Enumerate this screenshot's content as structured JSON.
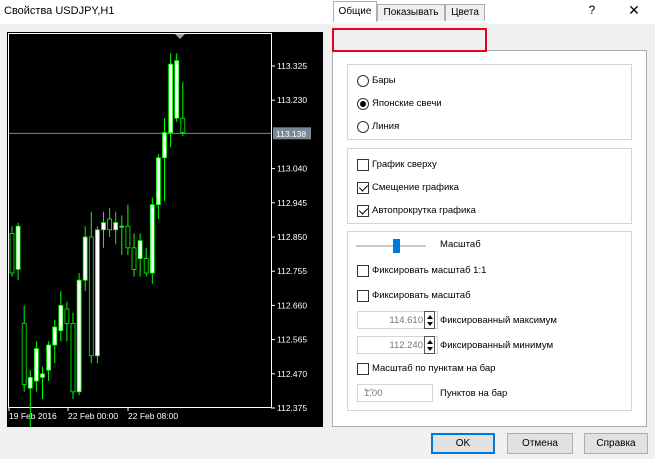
{
  "window": {
    "title": "Свойства USDJPY,H1",
    "help_label": "?",
    "close_label": "✕"
  },
  "chart": {
    "background_color": "#000000",
    "bull_color": "#ffffff",
    "bear_color": "#000000",
    "outline_color": "#00ff00",
    "price_line_color": "#778899",
    "current_price": "113.138",
    "price_ticks": [
      "113.325",
      "113.230",
      "113.040",
      "112.945",
      "112.850",
      "112.755",
      "112.660",
      "112.565",
      "112.470",
      "112.375"
    ],
    "time_ticks": [
      "19 Feb 2016",
      "22 Feb 00:00",
      "22 Feb 08:00"
    ],
    "candles": [
      {
        "o": 112.86,
        "h": 112.88,
        "l": 112.74,
        "c": 112.75
      },
      {
        "o": 112.76,
        "h": 112.89,
        "l": 112.73,
        "c": 112.88
      },
      {
        "o": 112.61,
        "h": 112.66,
        "l": 112.42,
        "c": 112.44
      },
      {
        "o": 112.43,
        "h": 112.48,
        "l": 112.32,
        "c": 112.46
      },
      {
        "o": 112.45,
        "h": 112.56,
        "l": 112.42,
        "c": 112.54
      },
      {
        "o": 112.46,
        "h": 112.49,
        "l": 112.4,
        "c": 112.47
      },
      {
        "o": 112.48,
        "h": 112.56,
        "l": 112.45,
        "c": 112.55
      },
      {
        "o": 112.55,
        "h": 112.62,
        "l": 112.5,
        "c": 112.6
      },
      {
        "o": 112.59,
        "h": 112.7,
        "l": 112.56,
        "c": 112.66
      },
      {
        "o": 112.65,
        "h": 112.67,
        "l": 112.56,
        "c": 112.61
      },
      {
        "o": 112.61,
        "h": 112.64,
        "l": 112.4,
        "c": 112.42
      },
      {
        "o": 112.42,
        "h": 112.75,
        "l": 112.41,
        "c": 112.73
      },
      {
        "o": 112.73,
        "h": 112.88,
        "l": 112.7,
        "c": 112.85
      },
      {
        "o": 112.85,
        "h": 112.92,
        "l": 112.5,
        "c": 112.52
      },
      {
        "o": 112.52,
        "h": 112.88,
        "l": 112.5,
        "c": 112.87
      },
      {
        "o": 112.87,
        "h": 112.92,
        "l": 112.82,
        "c": 112.89
      },
      {
        "o": 112.9,
        "h": 112.93,
        "l": 112.85,
        "c": 112.87
      },
      {
        "o": 112.87,
        "h": 112.92,
        "l": 112.83,
        "c": 112.89
      },
      {
        "o": 112.88,
        "h": 112.91,
        "l": 112.8,
        "c": 112.88
      },
      {
        "o": 112.88,
        "h": 112.94,
        "l": 112.8,
        "c": 112.82
      },
      {
        "o": 112.82,
        "h": 112.86,
        "l": 112.74,
        "c": 112.76
      },
      {
        "o": 112.79,
        "h": 112.86,
        "l": 112.74,
        "c": 112.84
      },
      {
        "o": 112.79,
        "h": 112.82,
        "l": 112.74,
        "c": 112.75
      },
      {
        "o": 112.75,
        "h": 112.96,
        "l": 112.72,
        "c": 112.94
      },
      {
        "o": 112.94,
        "h": 113.08,
        "l": 112.9,
        "c": 113.07
      },
      {
        "o": 113.07,
        "h": 113.18,
        "l": 112.95,
        "c": 113.14
      },
      {
        "o": 113.14,
        "h": 113.36,
        "l": 113.1,
        "c": 113.33
      },
      {
        "o": 113.18,
        "h": 113.36,
        "l": 113.17,
        "c": 113.34
      },
      {
        "o": 113.18,
        "h": 113.28,
        "l": 113.13,
        "c": 113.14
      }
    ]
  },
  "tabs": [
    {
      "label": "Общие",
      "active": true
    },
    {
      "label": "Показывать",
      "active": false
    },
    {
      "label": "Цвета",
      "active": false
    }
  ],
  "general": {
    "chart_type": [
      {
        "label": "Бары",
        "selected": false
      },
      {
        "label": "Японские свечи",
        "selected": true
      },
      {
        "label": "Линия",
        "selected": false
      }
    ],
    "options": [
      {
        "label": "График сверху",
        "checked": false
      },
      {
        "label": "Смещение графика",
        "checked": true
      },
      {
        "label": "Автопрокрутка графика",
        "checked": true
      }
    ],
    "scale_label": "Масштаб",
    "scale_level": 0.57,
    "fix_scale_1_1": {
      "label": "Фиксировать масштаб 1:1",
      "checked": false
    },
    "fix_scale": {
      "label": "Фиксировать масштаб",
      "checked": false
    },
    "fixed_max": {
      "value": "114.610",
      "label": "Фиксированный максимум"
    },
    "fixed_min": {
      "value": "112.240",
      "label": "Фиксированный минимум"
    },
    "points_per_bar": {
      "label": "Масштаб по пунктам на бар",
      "checked": false
    },
    "points_select": {
      "value": "1.00",
      "label": "Пунктов на бар"
    }
  },
  "buttons": {
    "ok": "OK",
    "cancel": "Отмена",
    "help": "Справка"
  },
  "colors": {
    "accent": "#0078d7",
    "highlight": "#e8001c"
  }
}
